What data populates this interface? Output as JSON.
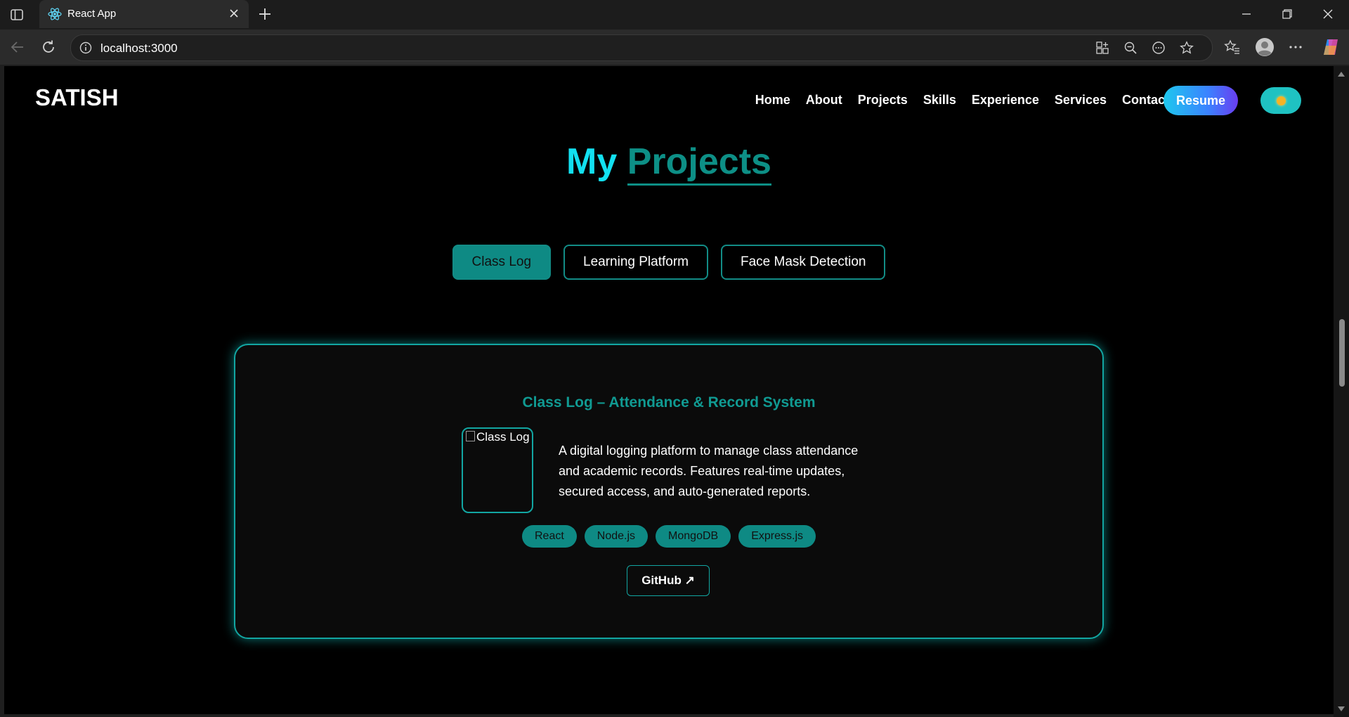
{
  "browser": {
    "tab_title": "React App",
    "url": "localhost:3000"
  },
  "icons": {
    "sidebar": "sidebar-toggle-icon",
    "tab": "react-logo-icon",
    "close": "close-icon",
    "new_tab": "plus-icon",
    "info": "info-icon",
    "apps": "app-available-icon",
    "zoom": "zoom-out-icon",
    "more": "more-icon",
    "favorite": "star-icon",
    "favorites": "favorites-icon",
    "profile": "profile-icon",
    "settings": "ellipsis-icon",
    "copilot": "copilot-icon"
  },
  "colors": {
    "accent": "#0e8a84",
    "cyan": "#12e0f0",
    "background": "#000000"
  },
  "navbar": {
    "logo": "SATISH",
    "links": [
      "Home",
      "About",
      "Projects",
      "Skills",
      "Experience",
      "Services",
      "Contact"
    ],
    "resume_label": "Resume"
  },
  "section": {
    "title_part1": "My",
    "title_part2": "Projects"
  },
  "filters": [
    {
      "label": "Class Log",
      "active": true
    },
    {
      "label": "Learning Platform",
      "active": false
    },
    {
      "label": "Face Mask Detection",
      "active": false
    }
  ],
  "project": {
    "title": "Class Log – Attendance & Record System",
    "image_alt": "Class Log",
    "description": "A digital logging platform to manage class attendance and academic records. Features real-time updates, secured access, and auto-generated reports.",
    "tags": [
      "React",
      "Node.js",
      "MongoDB",
      "Express.js"
    ],
    "github_label": "GitHub ↗"
  }
}
